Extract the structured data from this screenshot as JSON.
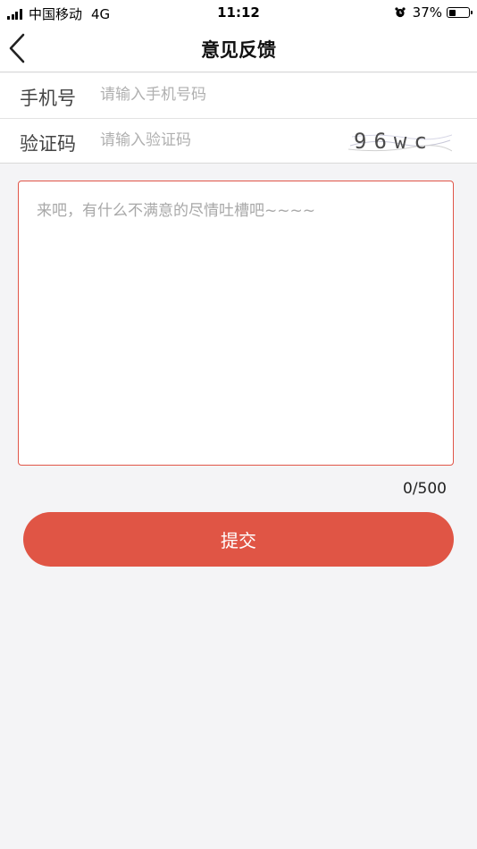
{
  "status_bar": {
    "carrier": "中国移动",
    "network": "4G",
    "time": "11:12",
    "battery_percent": "37%",
    "battery_level": 0.37
  },
  "nav": {
    "title": "意见反馈",
    "back_icon": "chevron-left-icon"
  },
  "form": {
    "phone": {
      "label": "手机号",
      "placeholder": "请输入手机号码",
      "value": ""
    },
    "code": {
      "label": "验证码",
      "placeholder": "请输入验证码",
      "value": "",
      "captcha_text": "96wc"
    }
  },
  "feedback": {
    "placeholder": "来吧，有什么不满意的尽情吐槽吧~~~~",
    "value": "",
    "counter": "0/500",
    "border_color": "#e05548"
  },
  "submit": {
    "label": "提交",
    "color": "#e05545"
  }
}
